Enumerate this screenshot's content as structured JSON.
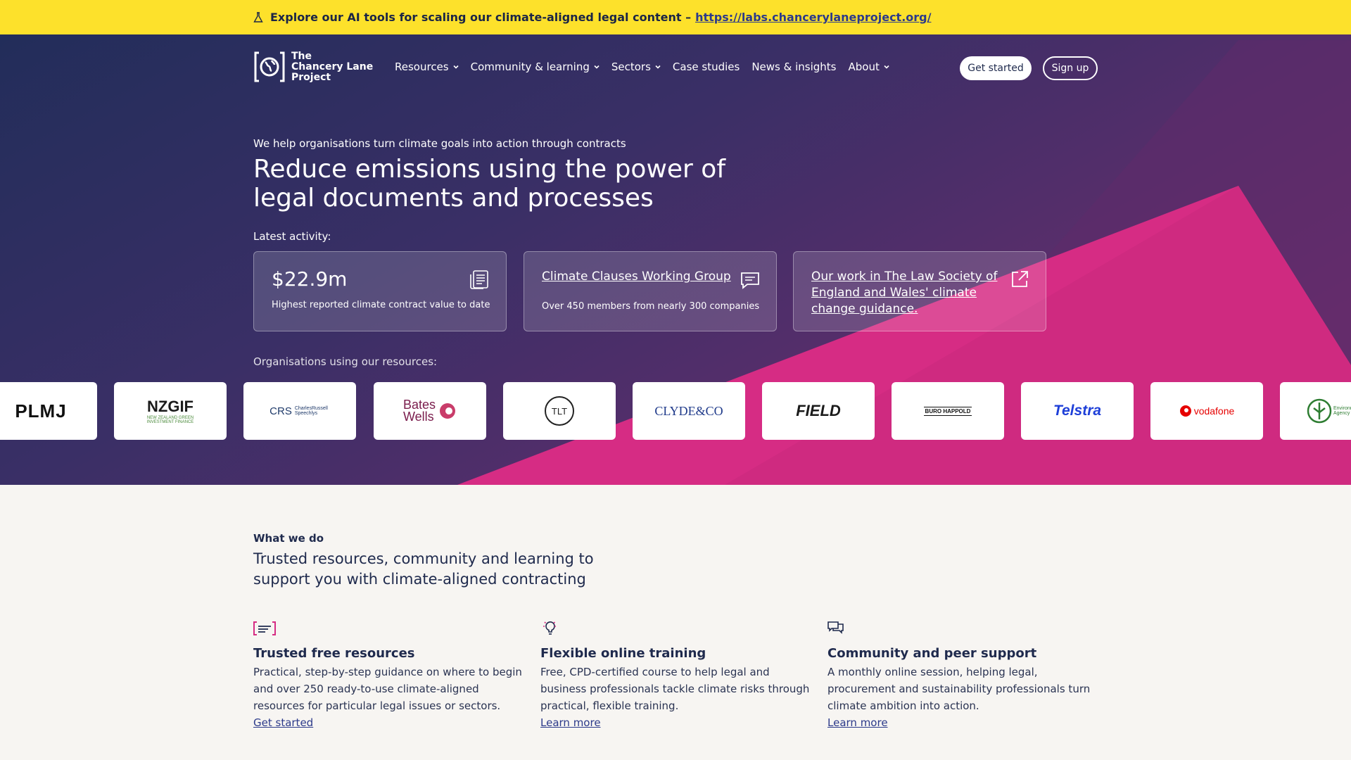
{
  "banner": {
    "text": "Explore our AI tools for scaling our climate-aligned legal content –",
    "link": "https://labs.chancerylaneproject.org/"
  },
  "logo": {
    "line1": "The",
    "line2": "Chancery Lane",
    "line3": "Project"
  },
  "nav": {
    "items": [
      {
        "label": "Resources",
        "dropdown": true
      },
      {
        "label": "Community & learning",
        "dropdown": true
      },
      {
        "label": "Sectors",
        "dropdown": true
      },
      {
        "label": "Case studies",
        "dropdown": false
      },
      {
        "label": "News & insights",
        "dropdown": false
      },
      {
        "label": "About",
        "dropdown": true
      }
    ],
    "get_started": "Get started",
    "sign_up": "Sign up"
  },
  "hero": {
    "kicker": "We help organisations turn climate goals into action through contracts",
    "title": "Reduce emissions using the power of legal documents and processes",
    "latest_label": "Latest activity:",
    "cards": [
      {
        "value": "$22.9m",
        "sub": "Highest reported climate contract value to date",
        "icon": "document-icon"
      },
      {
        "title": "Climate Clauses Working Group",
        "sub": "Over 450 members from nearly 300 companies",
        "icon": "chat-icon"
      },
      {
        "title": "Our work in The Law Society of England and Wales' climate change guidance.",
        "icon": "external-link-icon"
      }
    ],
    "orgs_label": "Organisations using our resources:",
    "org_logos": [
      {
        "name": "PLMJ",
        "color": "#111111"
      },
      {
        "name": "NZGIF",
        "sub": "NEW ZEALAND GREEN INVESTMENT FINANCE",
        "color": "#1b1b1b"
      },
      {
        "name": "CRS",
        "sub": "CharlesRussell Speechlys",
        "color": "#1f3a6a"
      },
      {
        "name": "Bates Wells",
        "color": "#7a1c4c"
      },
      {
        "name": "TLT",
        "color": "#222222"
      },
      {
        "name": "CLYDE&CO",
        "color": "#1f3a8a"
      },
      {
        "name": "FIELD",
        "color": "#1b1b1b"
      },
      {
        "name": "BURO HAPPOLD",
        "color": "#111111"
      },
      {
        "name": "Telstra",
        "color": "#1e3fd8"
      },
      {
        "name": "vodafone",
        "color": "#e60000"
      },
      {
        "name": "Environment Agency",
        "color": "#2e7d32"
      }
    ]
  },
  "what_we_do": {
    "label": "What we do",
    "title": "Trusted resources, community and learning to support you with climate-aligned contracting",
    "features": [
      {
        "icon": "resources-icon",
        "title": "Trusted free resources",
        "text": "Practical, step-by-step guidance on where to begin and over 250 ready-to-use climate-aligned resources for particular legal issues or sectors.",
        "link": "Get started"
      },
      {
        "icon": "lightbulb-icon",
        "title": "Flexible online training",
        "text": "Free, CPD-certified course to help legal and business professionals tackle climate risks through practical, flexible training.",
        "link": "Learn more"
      },
      {
        "icon": "speech-bubbles-icon",
        "title": "Community and peer support",
        "text": "A monthly online session, helping legal, procurement and sustainability professionals turn climate ambition into action.",
        "link": "Learn more"
      }
    ]
  }
}
